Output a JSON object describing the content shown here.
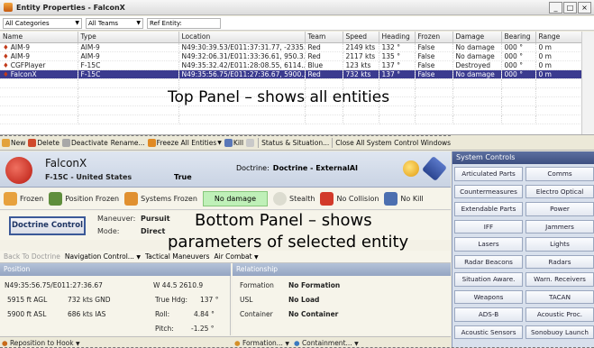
{
  "window": {
    "title": "Entity Properties - FalconX",
    "buttons": [
      "_",
      "□",
      "×"
    ]
  },
  "filters": {
    "categories": "All Categories",
    "teams": "All Teams",
    "ref_entity_label": "Ref Entity:"
  },
  "table": {
    "columns": [
      "Name",
      "Type",
      "Location",
      "Team",
      "Speed",
      "Heading",
      "Frozen",
      "Damage",
      "Bearing",
      "Range"
    ],
    "rows": [
      [
        "AIM-9",
        "AIM-9",
        "N49:30:39.53/E011:37:31.77, -2335...",
        "Red",
        "2149 kts",
        "132 °",
        "False",
        "No damage",
        "000 °",
        "0 m"
      ],
      [
        "AIM-9",
        "AIM-9",
        "N49:32:06.31/E011:33:36.61, 950.3...",
        "Red",
        "2117 kts",
        "135 °",
        "False",
        "No damage",
        "000 °",
        "0 m"
      ],
      [
        "CGFPlayer",
        "F-15C",
        "N49:35:32.42/E011:28:08.55, 6114....",
        "Blue",
        "123 kts",
        "137 °",
        "False",
        "Destroyed",
        "000 °",
        "0 m"
      ],
      [
        "FalconX",
        "F-15C",
        "N49:35:56.75/E011:27:36.67, 5900....",
        "Red",
        "732 kts",
        "137 °",
        "False",
        "No damage",
        "000 °",
        "0 m"
      ]
    ],
    "selected_row": 3,
    "overlay": "Top Panel – shows all entities"
  },
  "toolbar": {
    "new": "New",
    "delete": "Delete",
    "deactivate": "Deactivate",
    "rename": "Rename...",
    "freeze_all": "Freeze All Entities",
    "kill": "Kill",
    "status": "Status & Situation...",
    "close_all": "Close All System Control Windows"
  },
  "entity": {
    "name": "FalconX",
    "subtitle": "F-15C - United States",
    "active": "True",
    "doctrine_label": "Doctrine:",
    "doctrine_value": "Doctrine - ExternalAI"
  },
  "flags": {
    "frozen": "Frozen",
    "position_frozen": "Position Frozen",
    "systems_frozen": "Systems Frozen",
    "damage": "No damage",
    "stealth": "Stealth",
    "no_collision": "No Collision",
    "no_kill": "No Kill"
  },
  "controls": {
    "doctrine_button": "Doctrine Control",
    "maneuver_label": "Maneuver:",
    "maneuver_value": "Pursuit",
    "mode_label": "Mode:",
    "mode_value": "Direct"
  },
  "overlay_bottom": {
    "line1": "Bottom Panel – shows",
    "line2": "parameters of selected entity"
  },
  "nav": {
    "back": "Back To Doctrine",
    "navigation": "Navigation Control...",
    "tactical": "Tactical Maneuvers",
    "air_combat": "Air Combat"
  },
  "position": {
    "header": "Position",
    "lat": "N49:35:56.75/E011:27:36.67",
    "lon": "W 44.5 2610.9",
    "agl": "5915 ft AGL",
    "gnd": "732 kts GND",
    "asl": "5900 ft ASL",
    "ias": "686 kts IAS",
    "true_hdg_label": "True Hdg:",
    "true_hdg": "137 °",
    "roll_label": "Roll:",
    "roll": "4.84 °",
    "pitch_label": "Pitch:",
    "pitch": "-1.25 °"
  },
  "relationship": {
    "header": "Relationship",
    "formation_label": "Formation",
    "formation_value": "No Formation",
    "usl_label": "USL",
    "usl_value": "No Load",
    "container_label": "Container",
    "container_value": "No Container"
  },
  "footer": {
    "reposition": "Reposition to Hook",
    "formation": "Formation...",
    "containment": "Containment..."
  },
  "system_controls": {
    "header": "System Controls",
    "buttons": [
      "Articulated Parts",
      "Comms",
      "Countermeasures",
      "Electro Optical",
      "Extendable Parts",
      "Power",
      "IFF",
      "Jammers",
      "Lasers",
      "Lights",
      "Radar Beacons",
      "Radars",
      "Situation Aware.",
      "Warn. Receivers",
      "Weapons",
      "TACAN",
      "ADS-B",
      "Acoustic Proc.",
      "Acoustic Sensors",
      "Sonobuoy Launch"
    ]
  }
}
